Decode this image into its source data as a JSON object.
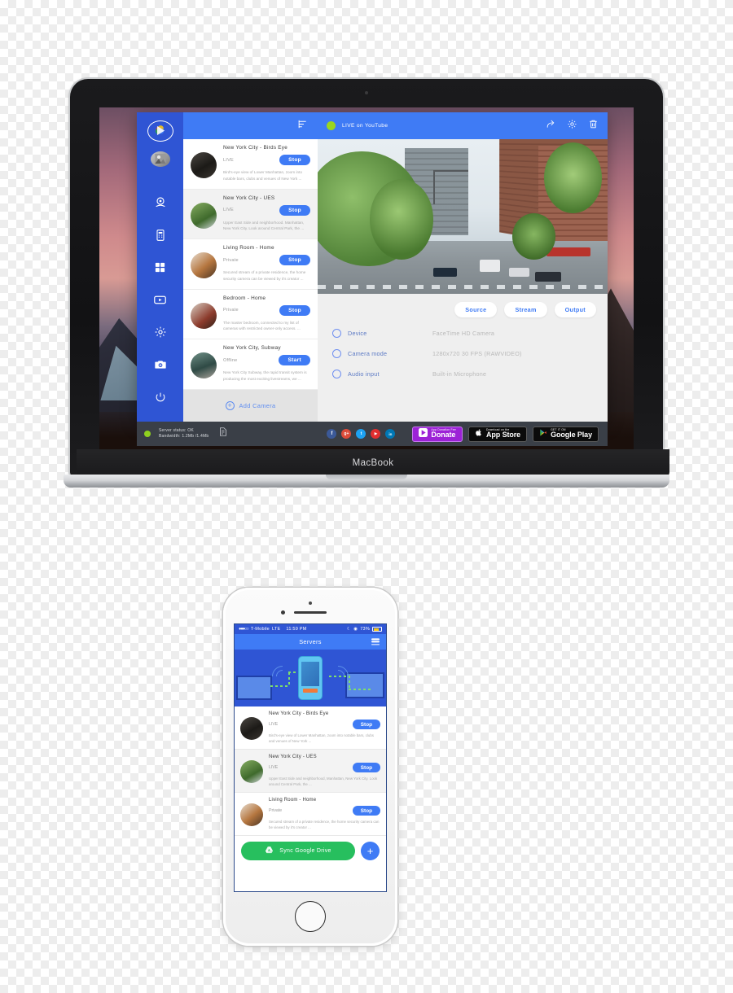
{
  "device": {
    "laptop_brand": "MacBook"
  },
  "app": {
    "sidebar": {
      "logo_icon": "play-logo-icon",
      "avatar_icon": "user-avatar-icon",
      "items": [
        {
          "icon": "webcam-icon",
          "name": "webcam"
        },
        {
          "icon": "mobile-device-icon",
          "name": "mobile"
        },
        {
          "icon": "grid-apps-icon",
          "name": "apps"
        },
        {
          "icon": "video-player-icon",
          "name": "video"
        },
        {
          "icon": "gear-icon",
          "name": "settings"
        },
        {
          "icon": "add-camera-icon",
          "name": "add-camera"
        }
      ],
      "power_icon": "power-icon"
    },
    "list_header": {
      "filter_icon": "filter-icon"
    },
    "top_bar": {
      "status_dot_color": "#9ad61e",
      "status_label": "LIVE on YouTube",
      "share_icon": "share-icon",
      "settings_icon": "gear-icon",
      "delete_icon": "trash-icon"
    },
    "cameras": [
      {
        "name": "New York City - Birds Eye",
        "state": "LIVE",
        "action": "Stop",
        "description": "Bird's-eye view of Lower Manhattan, zoom into notable bars, clubs and venues of New York ..."
      },
      {
        "name": "New York City - UES",
        "state": "LIVE",
        "action": "Stop",
        "description": "Upper East Side and neighborhood. Manhattan, New York City. Look around Central Park, the ..."
      },
      {
        "name": "Living Room - Home",
        "state": "Private",
        "action": "Stop",
        "description": "Secured stream of a private residence, the home security camera can be viewed by it's creator ..."
      },
      {
        "name": "Bedroom - Home",
        "state": "Private",
        "action": "Stop",
        "description": "The master bedroom, connected to my list of cameras with restricted owner-only access. ..."
      },
      {
        "name": "New York City, Subway",
        "state": "Offline",
        "action": "Start",
        "description": "New York City Subway, the rapid transit system is producing the most exciting livestreams, we ..."
      }
    ],
    "add_camera": {
      "label": "Add Camera",
      "icon": "plus-circle-icon"
    },
    "tabs": [
      {
        "label": "Source",
        "active": true
      },
      {
        "label": "Stream",
        "active": false
      },
      {
        "label": "Output",
        "active": false
      }
    ],
    "settings_rows": [
      {
        "label": "Device",
        "value": "FaceTime HD Camera"
      },
      {
        "label": "Camera mode",
        "value": "1280x720 30 FPS (RAWVIDEO)"
      },
      {
        "label": "Audio input",
        "value": "Built-in Microphone"
      }
    ],
    "status_bar": {
      "indicator_color": "#8fd11f",
      "line1": "Server status: OK",
      "line2": "Bandwidth: 1.2Mb /1.4Mb",
      "doc_icon": "document-icon",
      "socials": [
        {
          "name": "facebook-icon",
          "glyph": "f",
          "color": "#3b5998"
        },
        {
          "name": "google-plus-icon",
          "glyph": "g+",
          "color": "#dd4b39"
        },
        {
          "name": "twitter-icon",
          "glyph": "t",
          "color": "#1da1f2"
        },
        {
          "name": "youtube-icon",
          "glyph": "▶",
          "color": "#e02f2f"
        },
        {
          "name": "linkedin-icon",
          "glyph": "in",
          "color": "#0077b5"
        }
      ],
      "badges": [
        {
          "name": "donate-badge",
          "small": "App Donation Fee",
          "big": "Donate",
          "icon": "play-logo-icon"
        },
        {
          "name": "app-store-badge",
          "small": "Download on the",
          "big": "App Store",
          "icon": "apple-icon"
        },
        {
          "name": "google-play-badge",
          "small": "GET IT ON",
          "big": "Google Play",
          "icon": "google-play-icon"
        }
      ]
    }
  },
  "phone": {
    "status": {
      "carrier": "T-Mobile",
      "network": "LTE",
      "time": "11:59 PM",
      "battery": "73%"
    },
    "navbar": {
      "title": "Servers",
      "menu_icon": "hamburger-menu-icon"
    },
    "cameras": [
      {
        "name": "New York City - Birds Eye",
        "state": "LIVE",
        "action": "Stop",
        "description": "Bird's-eye view of Lower Manhattan, zoom into notable bars, clubs and venues of New York ..."
      },
      {
        "name": "New York City - UES",
        "state": "LIVE",
        "action": "Stop",
        "description": "Upper East Side and neighborhood, Manhattan, New York City. Look around Central Park, the ..."
      },
      {
        "name": "Living Room - Home",
        "state": "Private",
        "action": "Stop",
        "description": "Secured stream of a private residence, the home security camera can be viewed by it's creator ..."
      }
    ],
    "footer": {
      "sync_label": "Sync Google Drive",
      "sync_icon": "google-drive-icon",
      "add_label": "+",
      "add_icon": "plus-icon"
    }
  }
}
